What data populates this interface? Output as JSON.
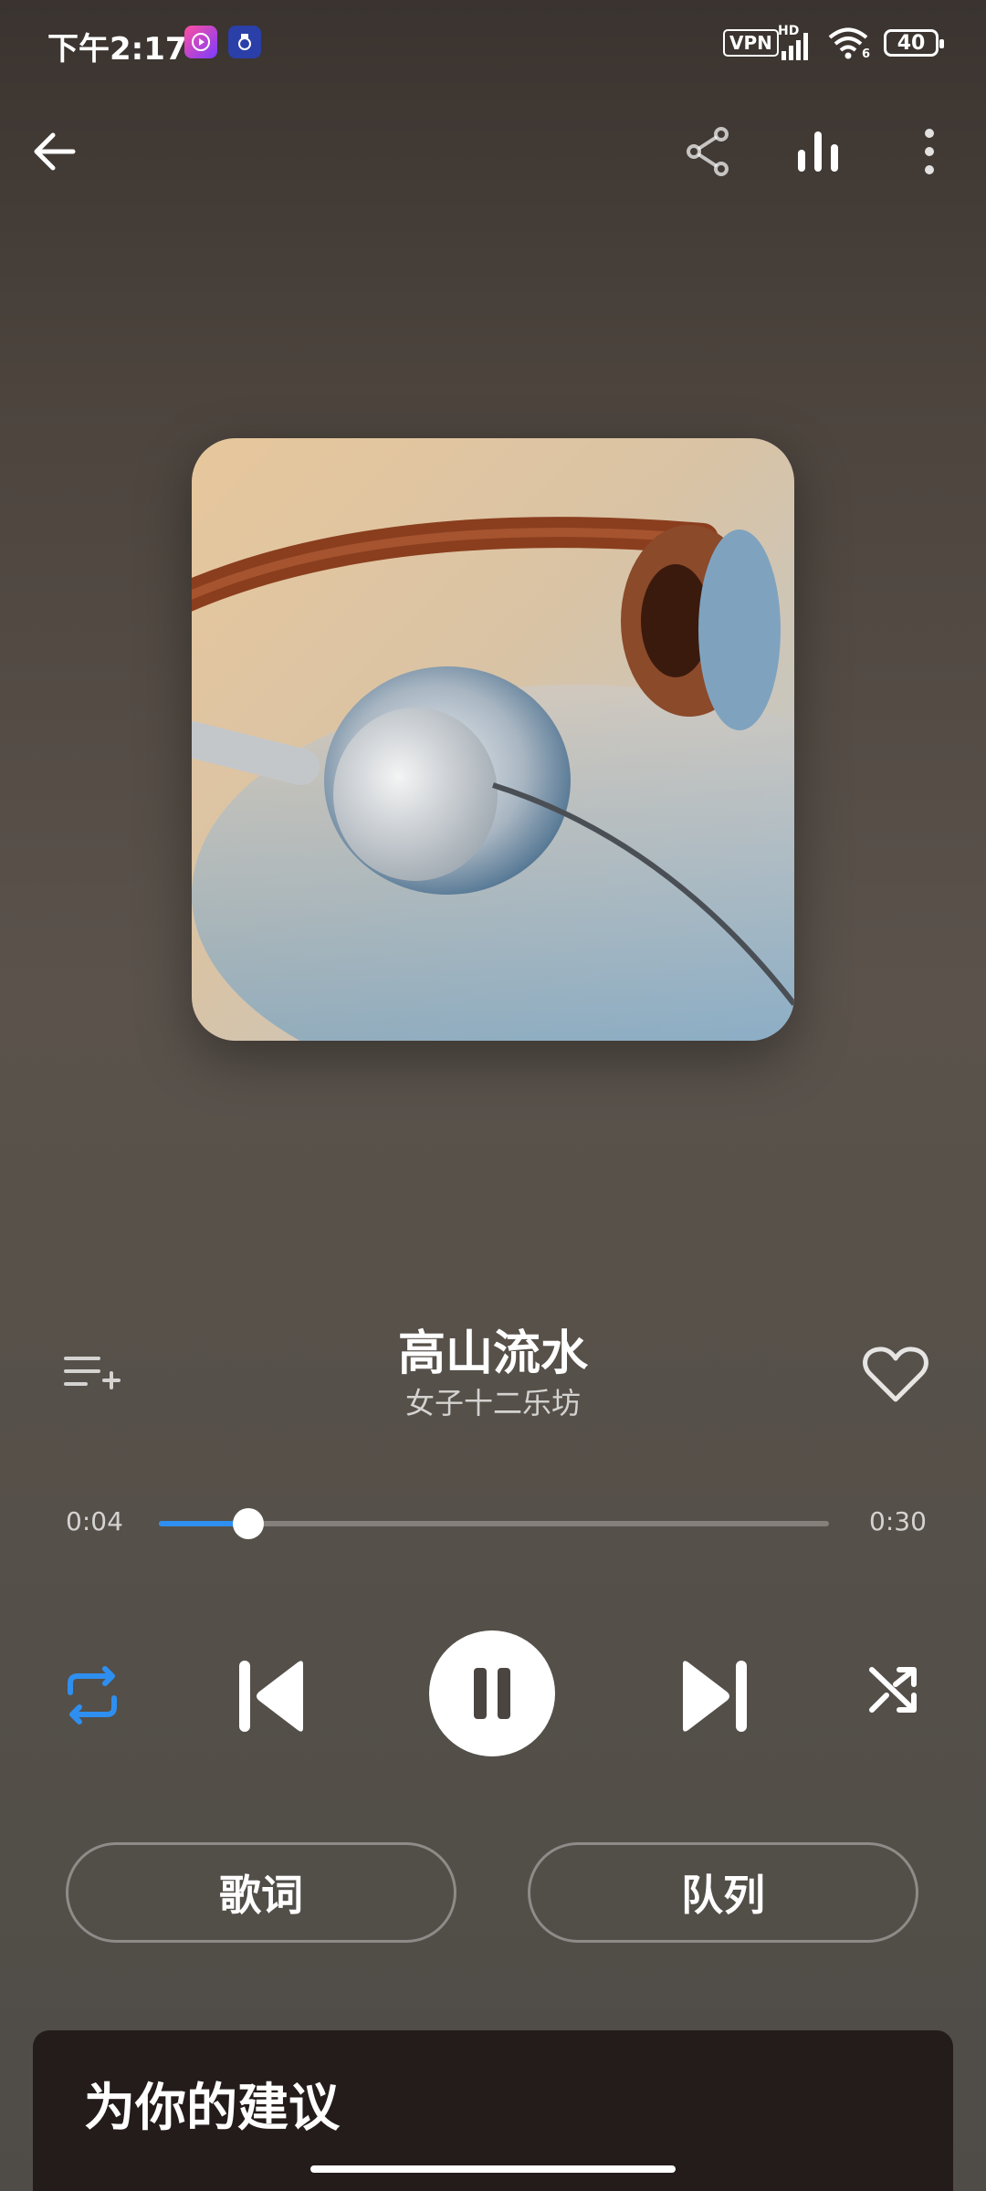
{
  "status_bar": {
    "time": "下午2:17",
    "vpn": "VPN",
    "network": "HD",
    "wifi_level": "6",
    "battery": "40"
  },
  "nav": {
    "icons": [
      "back-arrow-icon",
      "share-icon",
      "equalizer-icon",
      "more-vertical-icon"
    ]
  },
  "song": {
    "title": "高山流水",
    "artist": "女子十二乐坊"
  },
  "progress": {
    "elapsed": "0:04",
    "total": "0:30",
    "fraction": 0.1333
  },
  "controls": {
    "repeat_color": "#2e8ff0",
    "icons": [
      "repeat-icon",
      "previous-icon",
      "pause-icon",
      "next-icon",
      "shuffle-icon"
    ]
  },
  "buttons": {
    "lyrics": "歌词",
    "queue": "队列"
  },
  "suggestions": {
    "title": "为你的建议"
  }
}
